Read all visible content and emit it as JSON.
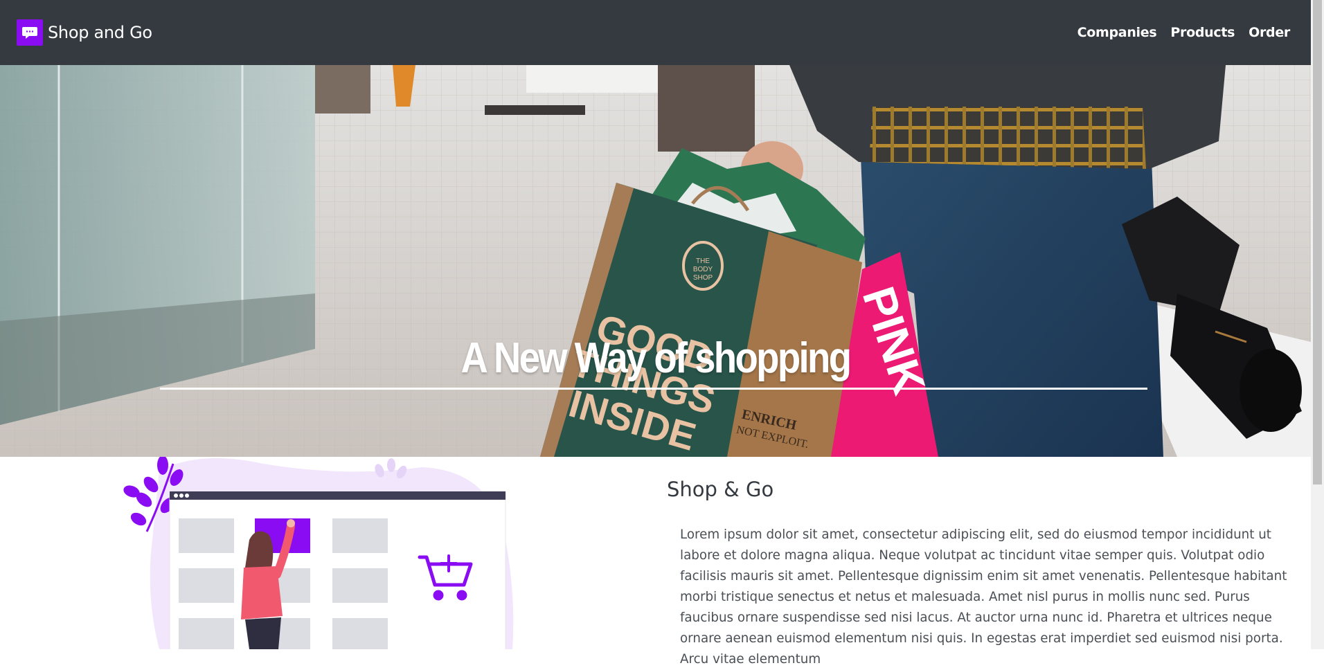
{
  "brand": {
    "name": "Shop and Go"
  },
  "nav": {
    "links": [
      "Companies",
      "Products",
      "Order"
    ]
  },
  "hero": {
    "title": "A New Way of shopping"
  },
  "bag_prints": {
    "body_shop": [
      "THE",
      "BODY",
      "SHOP"
    ],
    "good_things": [
      "GOOD",
      "THINGS",
      "INSIDE"
    ],
    "enrich": [
      "ENRICH",
      "NOT EXPLOIT."
    ],
    "pink": "PINK"
  },
  "colors": {
    "navbar": "#343a40",
    "accent": "#8a0cf3"
  },
  "section": {
    "title": "Shop & Go",
    "body": "Lorem ipsum dolor sit amet, consectetur adipiscing elit, sed do eiusmod tempor incididunt ut labore et dolore magna aliqua. Neque volutpat ac tincidunt vitae semper quis. Volutpat odio facilisis mauris sit amet. Pellentesque dignissim enim sit amet venenatis. Pellentesque habitant morbi tristique senectus et netus et malesuada. Amet nisl purus in mollis nunc sed. Purus faucibus ornare suspendisse sed nisi lacus. At auctor urna nunc id. Pharetra et ultrices neque ornare aenean euismod elementum nisi quis. In egestas erat imperdiet sed euismod nisi porta. Arcu vitae elementum"
  }
}
